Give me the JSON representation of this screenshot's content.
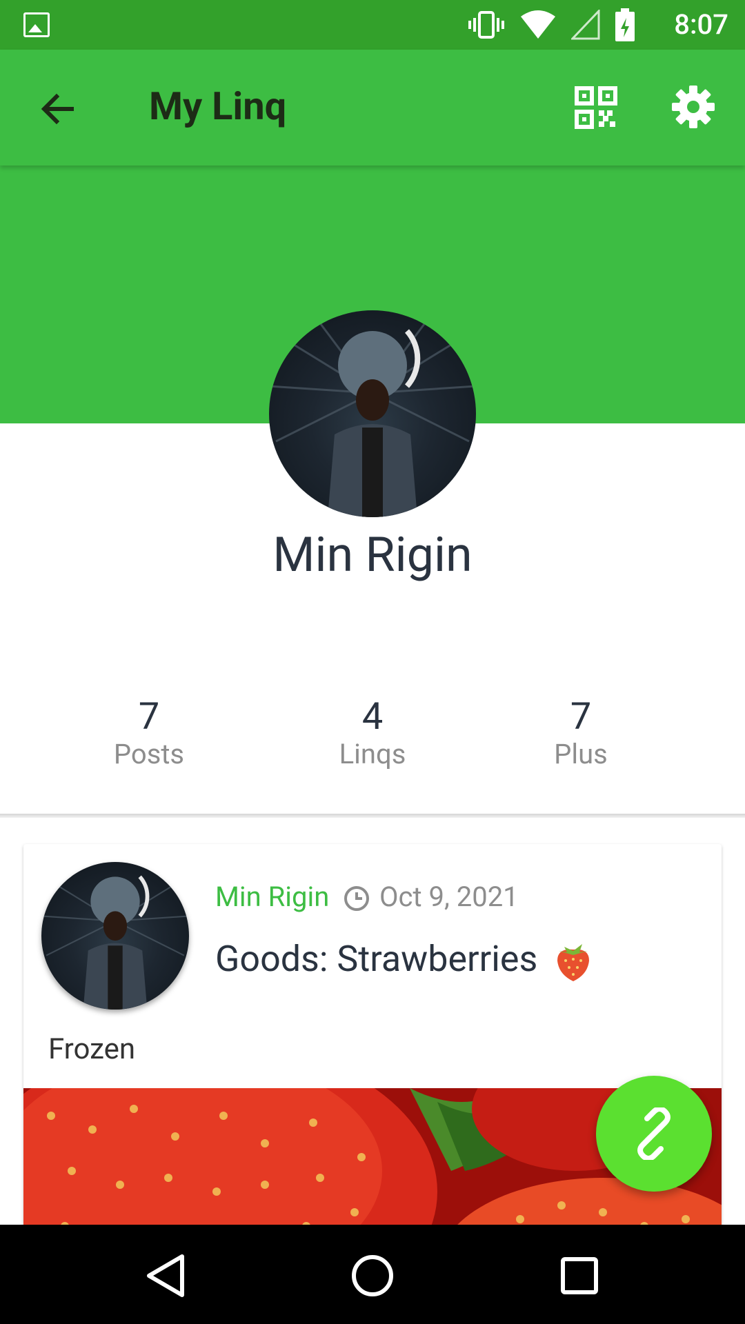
{
  "status_bar": {
    "time": "8:07",
    "icons": [
      "gallery-icon",
      "vibrate-icon",
      "wifi-icon",
      "cell-signal-icon",
      "battery-icon"
    ]
  },
  "app_bar": {
    "title": "My Linq",
    "icons": [
      "back-arrow-icon",
      "qr-code-icon",
      "gear-icon"
    ]
  },
  "profile": {
    "name": "Min Rigin"
  },
  "stats": [
    {
      "value": "7",
      "label": "Posts"
    },
    {
      "value": "4",
      "label": "Linqs"
    },
    {
      "value": "7",
      "label": "Plus"
    }
  ],
  "post": {
    "author": "Min Rigin",
    "date": "Oct 9, 2021",
    "title": "Goods: Strawberries",
    "description": "Frozen"
  },
  "fab": {
    "icon": "link-icon"
  },
  "nav_bar": {
    "icons": [
      "back-triangle-icon",
      "home-circle-icon",
      "recents-square-icon"
    ]
  },
  "colors": {
    "primary": "#3dbd43",
    "status_bar": "#33a12b",
    "fab": "#5be030",
    "text_dark": "#2a3340",
    "text_muted": "#8d8d8d"
  }
}
